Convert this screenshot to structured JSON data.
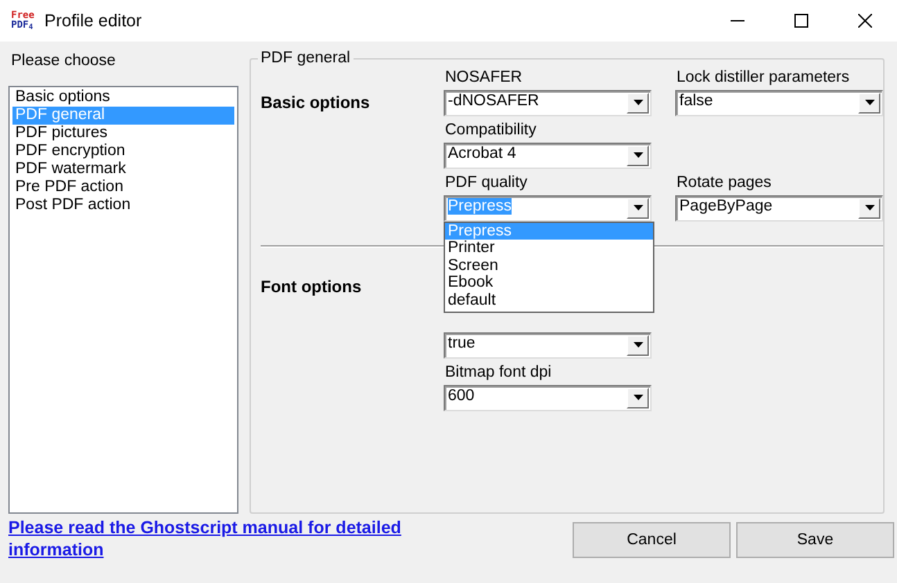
{
  "window": {
    "logo": [
      "Free",
      "PDF$_{4}$"
    ],
    "title": "Profile editor"
  },
  "sidebar": {
    "label": "Please choose",
    "items": [
      {
        "label": "Basic options",
        "selected": false
      },
      {
        "label": "PDF general",
        "selected": true
      },
      {
        "label": "PDF pictures",
        "selected": false
      },
      {
        "label": "PDF encryption",
        "selected": false
      },
      {
        "label": "PDF watermark",
        "selected": false
      },
      {
        "label": "Pre PDF action",
        "selected": false
      },
      {
        "label": "Post PDF action",
        "selected": false
      }
    ]
  },
  "group": {
    "title": "PDF general",
    "sections": [
      {
        "title": "Basic options",
        "rows": [
          [
            {
              "label": "NOSAFER",
              "value": "-dNOSAFER",
              "focused": false
            },
            {
              "label": "Lock distiller parameters",
              "value": "false",
              "focused": false
            }
          ],
          [
            {
              "label": "Compatibility",
              "value": "Acrobat 4",
              "focused": false
            }
          ],
          [
            {
              "label": "PDF quality",
              "value": "Prepress",
              "focused": true,
              "open_list": [
                {
                  "label": "Prepress",
                  "selected": true
                },
                {
                  "label": "Printer",
                  "selected": false
                },
                {
                  "label": "Screen",
                  "selected": false
                },
                {
                  "label": "Ebook",
                  "selected": false
                },
                {
                  "label": "default",
                  "selected": false
                }
              ]
            },
            {
              "label": "Rotate pages",
              "value": "PageByPage",
              "focused": false
            }
          ]
        ]
      },
      {
        "title": "Font options",
        "rows": [
          [
            {
              "value": "true",
              "focused": false
            }
          ],
          [
            {
              "label": "Bitmap font dpi",
              "value": "600",
              "focused": false
            }
          ]
        ]
      }
    ]
  },
  "footer": {
    "link": "Please read the Ghostscript manual for detailed information",
    "buttons": [
      "Cancel",
      "Save"
    ]
  }
}
